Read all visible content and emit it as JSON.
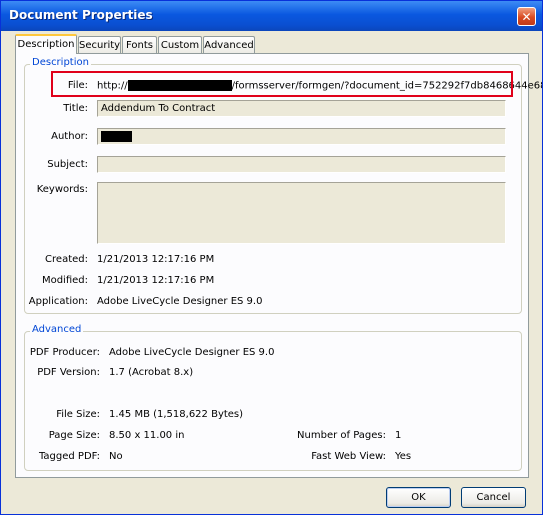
{
  "window": {
    "title": "Document Properties"
  },
  "tabs": [
    {
      "label": "Description",
      "active": true
    },
    {
      "label": "Security"
    },
    {
      "label": "Fonts"
    },
    {
      "label": "Custom"
    },
    {
      "label": "Advanced"
    }
  ],
  "description": {
    "group_label": "Description",
    "file_label": "File:",
    "file_prefix": "http://",
    "file_suffix": "/formsserver/formgen/?document_id=752292f7db8468644e68",
    "title_label": "Title:",
    "title_value": "Addendum To Contract",
    "author_label": "Author:",
    "subject_label": "Subject:",
    "subject_value": "",
    "keywords_label": "Keywords:",
    "keywords_value": "",
    "created_label": "Created:",
    "created_value": "1/21/2013 12:17:16 PM",
    "modified_label": "Modified:",
    "modified_value": "1/21/2013 12:17:16 PM",
    "application_label": "Application:",
    "application_value": "Adobe LiveCycle Designer ES 9.0"
  },
  "advanced": {
    "group_label": "Advanced",
    "producer_label": "PDF Producer:",
    "producer_value": "Adobe LiveCycle Designer ES 9.0",
    "version_label": "PDF Version:",
    "version_value": "1.7 (Acrobat 8.x)",
    "filesize_label": "File Size:",
    "filesize_value": "1.45 MB (1,518,622 Bytes)",
    "pagesize_label": "Page Size:",
    "pagesize_value": "8.50 x 11.00 in",
    "pages_label": "Number of Pages:",
    "pages_value": "1",
    "tagged_label": "Tagged PDF:",
    "tagged_value": "No",
    "fastweb_label": "Fast Web View:",
    "fastweb_value": "Yes"
  },
  "buttons": {
    "ok": "OK",
    "cancel": "Cancel"
  },
  "colors": {
    "highlight": "#e0001a",
    "titlebar": "#0a58e0",
    "group_label": "#0046d5"
  }
}
